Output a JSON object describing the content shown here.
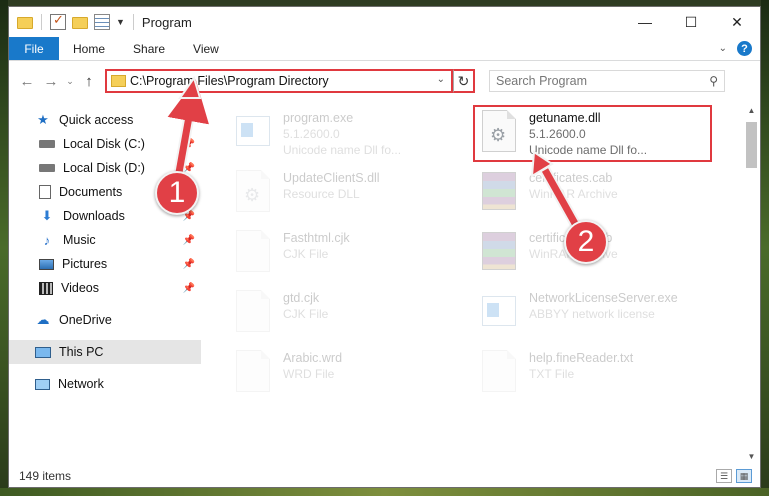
{
  "window": {
    "title": "Program",
    "controls": {
      "minimize": "—",
      "maximize": "☐",
      "close": "✕"
    }
  },
  "ribbon": {
    "file_tab": "File",
    "tabs": [
      "Home",
      "Share",
      "View"
    ]
  },
  "address_bar": {
    "path": "C:\\Program Files\\Program Directory"
  },
  "search": {
    "placeholder": "Search Program"
  },
  "sidebar": {
    "quick_access": "Quick access",
    "items": [
      {
        "label": "Local Disk (C:)",
        "icon": "drive-icon"
      },
      {
        "label": "Local Disk (D:)",
        "icon": "drive-icon"
      },
      {
        "label": "Documents",
        "icon": "documents-icon"
      },
      {
        "label": "Downloads",
        "icon": "downloads-icon"
      },
      {
        "label": "Music",
        "icon": "music-icon"
      },
      {
        "label": "Pictures",
        "icon": "pictures-icon"
      },
      {
        "label": "Videos",
        "icon": "videos-icon"
      }
    ],
    "onedrive": "OneDrive",
    "this_pc": "This PC",
    "network": "Network"
  },
  "files": [
    {
      "name": "program.exe",
      "line2": "5.1.2600.0",
      "line3": "Unicode name Dll fo...",
      "icon": "setup-icon",
      "faded": true
    },
    {
      "name": "getuname.dll",
      "line2": "5.1.2600.0",
      "line3": "Unicode name Dll fo...",
      "icon": "dll-gear-icon",
      "faded": false
    },
    {
      "name": "UpdateClientS.dll",
      "line2": "Resource DLL",
      "line3": "",
      "icon": "dll-gear-icon",
      "faded": true
    },
    {
      "name": "certificates.cab",
      "line2": "WinRAR Archive",
      "line3": "",
      "icon": "winrar-icon",
      "faded": true
    },
    {
      "name": "Fasthtml.cjk",
      "line2": "CJK File",
      "line3": "",
      "icon": "blank-file-icon",
      "faded": true
    },
    {
      "name": "certificates.cab",
      "line2": "WinRAR Archive",
      "line3": "",
      "icon": "winrar-icon",
      "faded": true
    },
    {
      "name": "gtd.cjk",
      "line2": "CJK File",
      "line3": "",
      "icon": "blank-file-icon",
      "faded": true
    },
    {
      "name": "NetworkLicenseServer.exe",
      "line2": "ABBYY network license",
      "line3": "",
      "icon": "exe-window-icon",
      "faded": true
    },
    {
      "name": "Arabic.wrd",
      "line2": "WRD File",
      "line3": "",
      "icon": "blank-file-icon",
      "faded": true
    },
    {
      "name": "help.fineReader.txt",
      "line2": "TXT File",
      "line3": "",
      "icon": "text-file-icon",
      "faded": true
    }
  ],
  "status": {
    "items_count": "149 items"
  },
  "callouts": [
    "1",
    "2"
  ],
  "colors": {
    "accent": "#1979ca",
    "highlight": "#e0393f",
    "badge": "#e14046"
  }
}
